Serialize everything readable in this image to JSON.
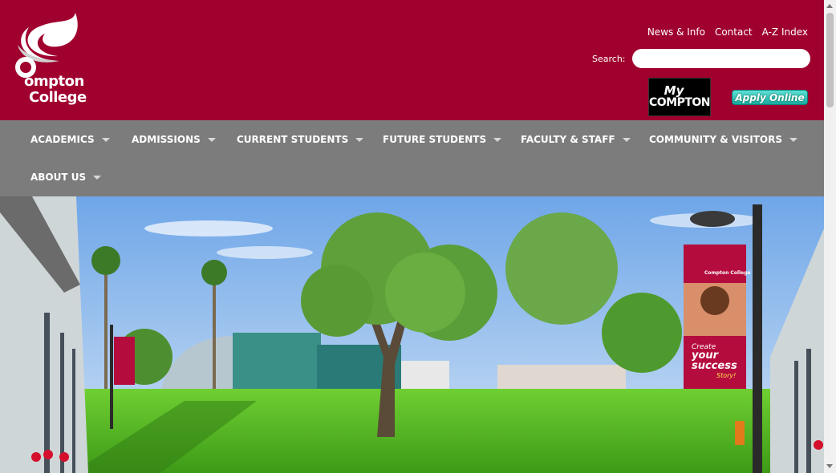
{
  "logo": {
    "line1": "ompton",
    "line2": "College",
    "icon": "compton-college-swirl-logo"
  },
  "top_links": [
    "News & Info",
    "Contact",
    "A-Z Index"
  ],
  "search": {
    "label": "Search:",
    "value": "",
    "placeholder": ""
  },
  "mycompton": {
    "my": "My",
    "compton": "COMPTON"
  },
  "apply": {
    "label": "Apply Online"
  },
  "nav": [
    {
      "label": "ACADEMICS"
    },
    {
      "label": "ADMISSIONS"
    },
    {
      "label": "CURRENT STUDENTS"
    },
    {
      "label": "FUTURE STUDENTS"
    },
    {
      "label": "FACULTY & STAFF"
    },
    {
      "label": "COMMUNITY & VISITORS"
    },
    {
      "label": "ABOUT US"
    }
  ],
  "hero": {
    "banner": {
      "brand": "Compton College",
      "line1": "Create",
      "line2": "your",
      "line3": "success",
      "line4": "Story!"
    }
  },
  "colors": {
    "brand": "#a0002e",
    "nav": "#7c7c7c",
    "apply": "#1aa9a0"
  }
}
